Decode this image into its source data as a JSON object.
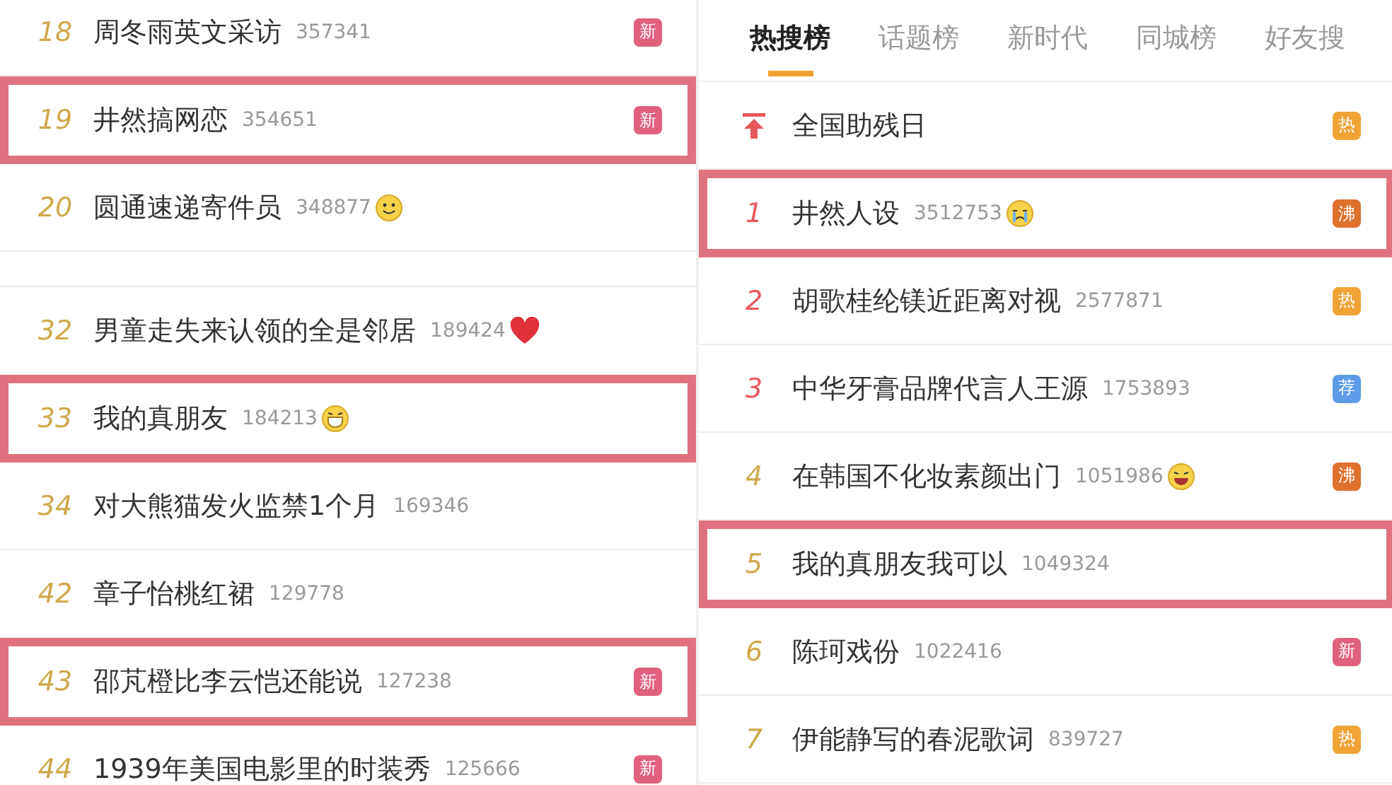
{
  "left_panel": {
    "sections": [
      {
        "rows": [
          {
            "kind": "ranked",
            "rank": "18",
            "top": false,
            "title": "周冬雨英文采访",
            "count": "357341",
            "highlighted": false,
            "badge": {
              "text": "新",
              "color": "#e0607e"
            }
          },
          {
            "kind": "ranked",
            "rank": "19",
            "top": false,
            "title": "井然搞网恋",
            "count": "354651",
            "highlighted": true,
            "badge": {
              "text": "新",
              "color": "#e0607e"
            }
          },
          {
            "kind": "ranked",
            "rank": "20",
            "top": false,
            "title": "圆通速递寄件员",
            "count": "348877",
            "highlighted": false,
            "emoji": {
              "kind": "smile"
            }
          }
        ]
      },
      {
        "rows": [
          {
            "kind": "ranked",
            "rank": "32",
            "top": false,
            "title": "男童走失来认领的全是邻居",
            "count": "189424",
            "highlighted": false,
            "emoji": {
              "kind": "heart"
            }
          },
          {
            "kind": "ranked",
            "rank": "33",
            "top": false,
            "title": "我的真朋友",
            "count": "184213",
            "highlighted": true,
            "emoji": {
              "kind": "grin"
            }
          },
          {
            "kind": "ranked",
            "rank": "34",
            "top": false,
            "title": "对大熊猫发火监禁1个月",
            "count": "169346",
            "highlighted": false
          },
          {
            "kind": "ranked",
            "rank": "42",
            "top": false,
            "title": "章子怡桃红裙",
            "count": "129778",
            "highlighted": false
          },
          {
            "kind": "ranked",
            "rank": "43",
            "top": false,
            "title": "邵芃橙比李云恺还能说",
            "count": "127238",
            "highlighted": true,
            "badge": {
              "text": "新",
              "color": "#e0607e"
            }
          },
          {
            "kind": "ranked",
            "rank": "44",
            "top": false,
            "title": "1939年美国电影里的时装秀",
            "count": "125666",
            "highlighted": false,
            "badge": {
              "text": "新",
              "color": "#e0607e"
            }
          }
        ]
      }
    ]
  },
  "right_panel": {
    "tabs": [
      {
        "label": "热搜榜",
        "selected": true
      },
      {
        "label": "话题榜",
        "selected": false
      },
      {
        "label": "新时代",
        "selected": false
      },
      {
        "label": "同城榜",
        "selected": false
      },
      {
        "label": "好友搜",
        "selected": false
      }
    ],
    "rows": [
      {
        "kind": "pinned",
        "title": "全国助残日",
        "highlighted": false,
        "badge": {
          "text": "热",
          "color": "#f0a436"
        }
      },
      {
        "kind": "ranked",
        "rank": "1",
        "top": true,
        "title": "井然人设",
        "count": "3512753",
        "highlighted": true,
        "emoji": {
          "kind": "cry"
        },
        "badge": {
          "text": "沸",
          "color": "#e0702e"
        }
      },
      {
        "kind": "ranked",
        "rank": "2",
        "top": true,
        "title": "胡歌桂纶镁近距离对视",
        "count": "2577871",
        "highlighted": false,
        "badge": {
          "text": "热",
          "color": "#f0a436"
        }
      },
      {
        "kind": "ranked",
        "rank": "3",
        "top": true,
        "title": "中华牙膏品牌代言人王源",
        "count": "1753893",
        "highlighted": false,
        "badge": {
          "text": "荐",
          "color": "#5b9be8"
        }
      },
      {
        "kind": "ranked",
        "rank": "4",
        "top": false,
        "title": "在韩国不化妆素颜出门",
        "count": "1051986",
        "highlighted": false,
        "emoji": {
          "kind": "laugh"
        },
        "badge": {
          "text": "沸",
          "color": "#e0702e"
        }
      },
      {
        "kind": "ranked",
        "rank": "5",
        "top": false,
        "title": "我的真朋友我可以",
        "count": "1049324",
        "highlighted": true
      },
      {
        "kind": "ranked",
        "rank": "6",
        "top": false,
        "title": "陈珂戏份",
        "count": "1022416",
        "highlighted": false,
        "badge": {
          "text": "新",
          "color": "#e0607e"
        }
      },
      {
        "kind": "ranked",
        "rank": "7",
        "top": false,
        "title": "伊能静写的春泥歌词",
        "count": "839727",
        "highlighted": false,
        "badge": {
          "text": "热",
          "color": "#f0a436"
        }
      }
    ]
  }
}
